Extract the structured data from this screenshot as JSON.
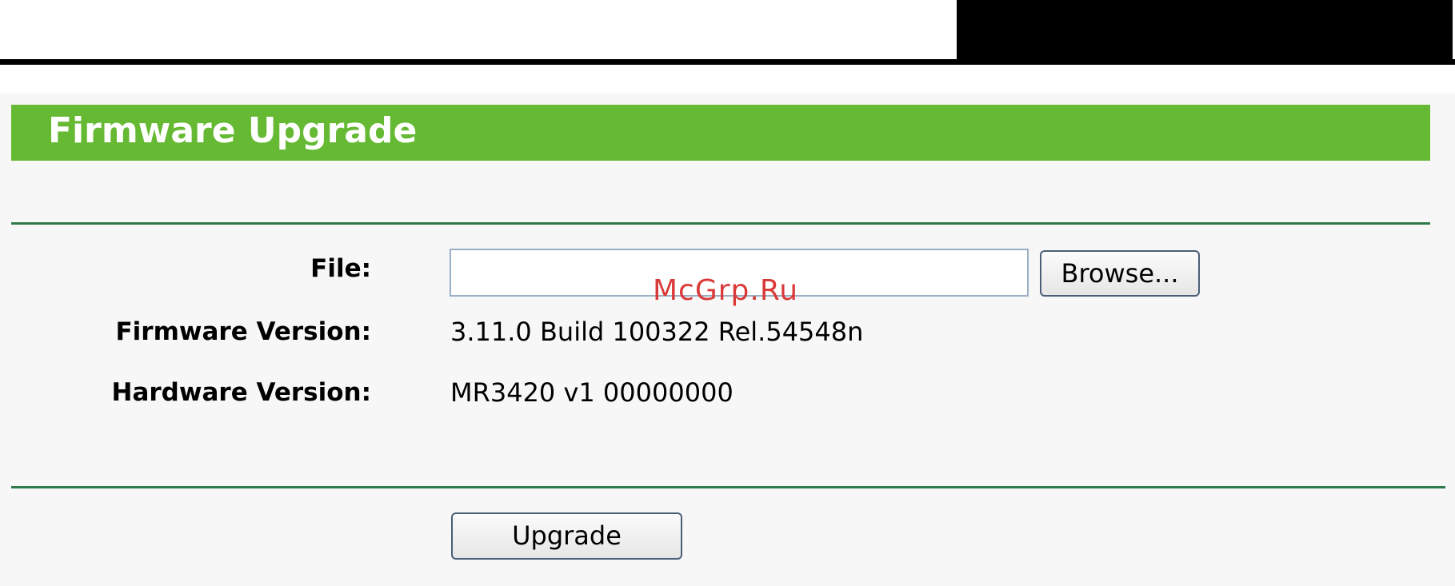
{
  "page": {
    "title": "Firmware Upgrade",
    "watermark": "McGrp.Ru"
  },
  "form": {
    "file_label": "File:",
    "file_value": "",
    "browse_label": "Browse...",
    "firmware_label": "Firmware Version:",
    "firmware_value": "3.11.0 Build 100322 Rel.54548n",
    "hardware_label": "Hardware Version:",
    "hardware_value": "MR3420 v1 00000000",
    "upgrade_label": "Upgrade"
  },
  "colors": {
    "title_bar": "#66b933",
    "divider": "#2f7a4a",
    "watermark": "#d93a3a",
    "panel_background": "#f7f7f7"
  }
}
